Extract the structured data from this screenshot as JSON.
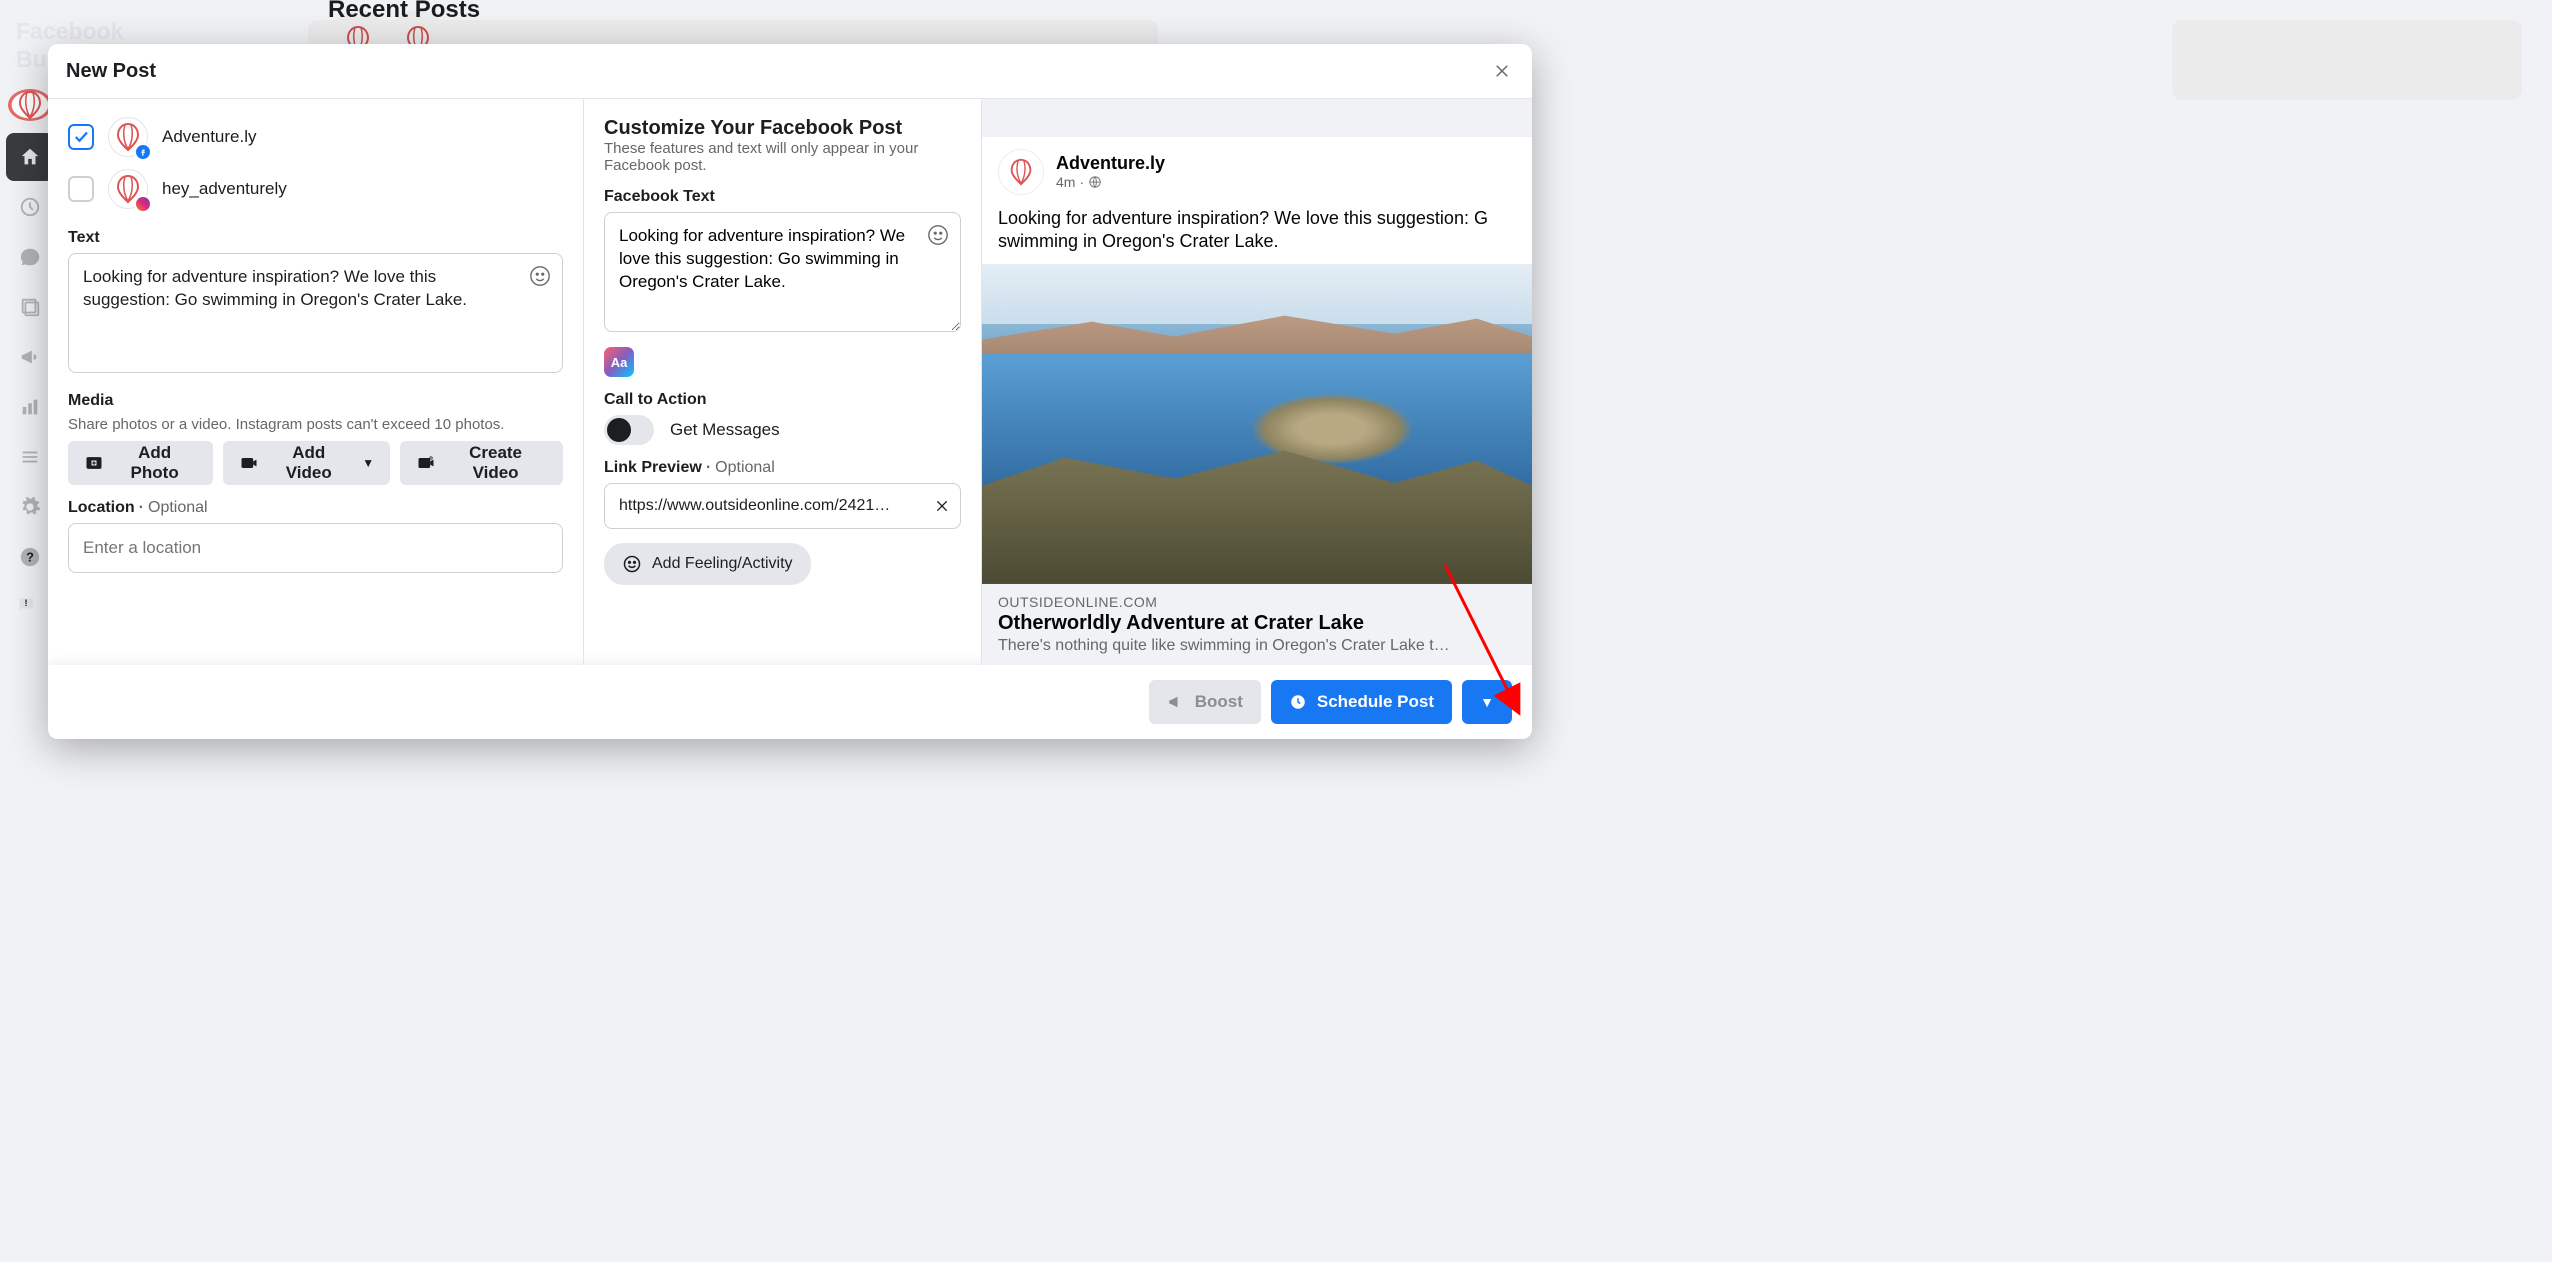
{
  "app": {
    "name_line1": "Facebook",
    "name_line2": "Busi…"
  },
  "sidebar": {
    "feedback": "Give Feedback"
  },
  "background": {
    "recent_posts": "Recent Posts"
  },
  "modal": {
    "title": "New Post",
    "accounts": [
      {
        "name": "Adventure.ly",
        "network": "facebook",
        "checked": true
      },
      {
        "name": "hey_adventurely",
        "network": "instagram",
        "checked": false
      }
    ],
    "text": {
      "label": "Text",
      "value": "Looking for adventure inspiration? We love this suggestion: Go swimming in Oregon's Crater Lake."
    },
    "media": {
      "label": "Media",
      "hint": "Share photos or a video. Instagram posts can't exceed 10 photos.",
      "add_photo": "Add Photo",
      "add_video": "Add Video",
      "create_video": "Create Video"
    },
    "location": {
      "label": "Location",
      "optional": "Optional",
      "placeholder": "Enter a location"
    }
  },
  "customize": {
    "title": "Customize Your Facebook Post",
    "subtitle": "These features and text will only appear in your Facebook post.",
    "fb_text_label": "Facebook Text",
    "fb_text_value": "Looking for adventure inspiration? We love this suggestion: Go swimming in Oregon's Crater Lake.",
    "cta_label": "Call to Action",
    "cta_option": "Get Messages",
    "cta_on": false,
    "link_preview_label": "Link Preview",
    "link_preview_optional": "Optional",
    "link_url": "https://www.outsideonline.com/2421…",
    "feeling_btn": "Add Feeling/Activity"
  },
  "preview": {
    "page_name": "Adventure.ly",
    "age": "4m",
    "body": "Looking for adventure inspiration? We love this suggestion: G swimming in Oregon's Crater Lake.",
    "link": {
      "domain": "OUTSIDEONLINE.COM",
      "title": "Otherworldly Adventure at Crater Lake",
      "desc": "There's nothing quite like swimming in Oregon's Crater Lake t…"
    }
  },
  "footer": {
    "boost": "Boost",
    "schedule": "Schedule Post"
  }
}
